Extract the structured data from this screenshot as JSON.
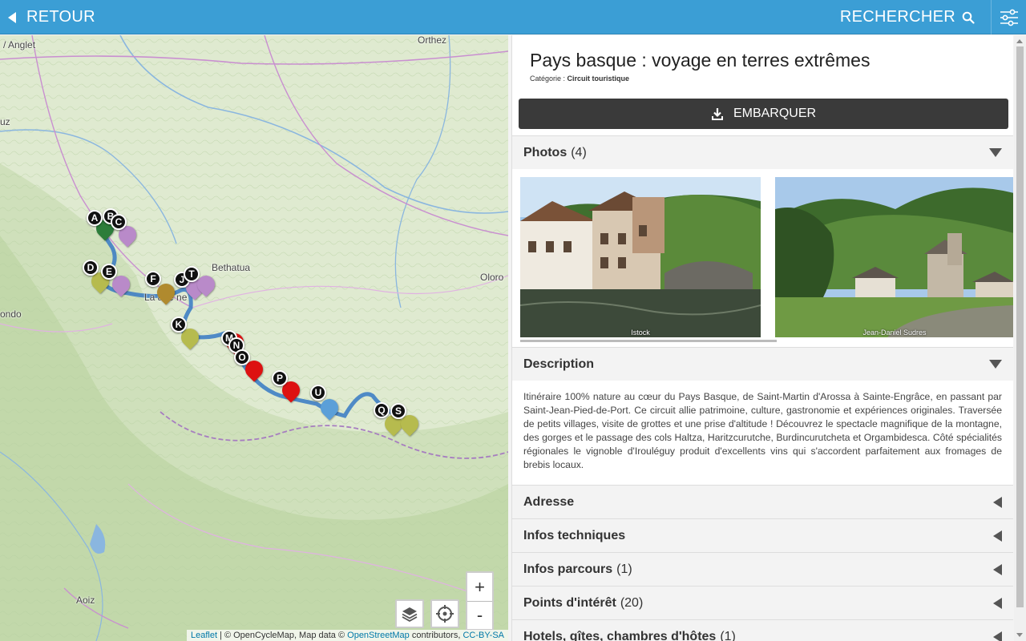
{
  "topbar": {
    "back_label": "RETOUR",
    "search_label": "RECHERCHER",
    "back_icon": "triangle-left-icon",
    "search_icon": "search-icon",
    "filter_icon": "sliders-icon",
    "color": "#3b9ed5"
  },
  "map": {
    "places": {
      "anglet": "/ Anglet",
      "orthez": "Orthez",
      "uz": "uz",
      "bethatua": "Bethatua",
      "oloron": "Oloro",
      "ondo": "ondo",
      "aoiz": "Aoiz",
      "lahadene": "La ade ne"
    },
    "markers": [
      "A",
      "B",
      "C",
      "D",
      "E",
      "F",
      "J",
      "T",
      "K",
      "M",
      "N",
      "O",
      "P",
      "U",
      "Q",
      "S"
    ],
    "zoom_in": "+",
    "zoom_out": "-",
    "layers_icon": "layers-icon",
    "locate_icon": "crosshair-icon",
    "attribution": {
      "leaflet": "Leaflet",
      "sep1": " | © OpenCycleMap, Map data © ",
      "osm": "OpenStreetMap",
      "sep2": " contributors, ",
      "license": "CC-BY-SA"
    }
  },
  "detail": {
    "title": "Pays basque : voyage en terres extrêmes",
    "category_label": "Catégorie : ",
    "category_value": "Circuit touristique",
    "embark_label": "EMBARQUER",
    "embark_icon": "download-icon",
    "photos": {
      "name": "Photos",
      "count": "(4)",
      "items": [
        {
          "caption": "Istock"
        },
        {
          "caption": "Jean-Daniel Sudres"
        }
      ]
    },
    "description": {
      "name": "Description",
      "text": "Itinéraire 100% nature au cœur du Pays Basque, de Saint-Martin d'Arossa à Sainte-Engrâce, en passant par Saint-Jean-Pied-de-Port. Ce circuit allie patrimoine, culture, gastronomie et expériences originales. Traversée de petits villages, visite de grottes et une prise d'altitude ! Découvrez le spectacle magnifique de la montagne, des gorges et le passage des cols Haltza, Haritzcurutche, Burdincurutcheta et Orgambidesca. Côté spécialités régionales le vignoble d'Irouléguy produit d'excellents vins qui s'accordent parfaitement aux fromages de brebis locaux."
    },
    "sections": [
      {
        "name": "Adresse",
        "count": ""
      },
      {
        "name": "Infos techniques",
        "count": ""
      },
      {
        "name": "Infos parcours",
        "count": "(1)"
      },
      {
        "name": "Points d'intérêt",
        "count": "(20)"
      },
      {
        "name": "Hotels, gîtes, chambres d'hôtes",
        "count": "(1)"
      }
    ]
  }
}
